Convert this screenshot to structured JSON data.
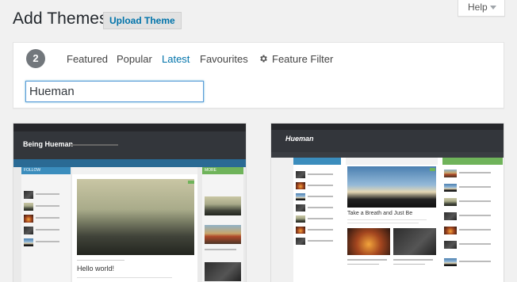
{
  "header": {
    "title": "Add Themes",
    "upload_label": "Upload Theme",
    "help_label": "Help"
  },
  "filter": {
    "count": "2",
    "tabs": [
      {
        "label": "Featured",
        "active": false
      },
      {
        "label": "Popular",
        "active": false
      },
      {
        "label": "Latest",
        "active": true
      },
      {
        "label": "Favourites",
        "active": false
      },
      {
        "label": "Feature Filter",
        "icon": "gear-icon",
        "active": false
      }
    ],
    "search_value": "Hueman"
  },
  "themes": [
    {
      "preview": {
        "site_title": "Being Hueman",
        "sidebar_label": "FOLLOW",
        "right_label": "MORE",
        "post_title": "Hello world!"
      }
    },
    {
      "preview": {
        "logo": "Hueman",
        "post_title": "Take a Breath and Just Be"
      }
    }
  ],
  "colors": {
    "accent": "#0073aa",
    "hueman_green": "#6fb35a",
    "hueman_blue": "#3b8dbd",
    "hueman_dark": "#33363b"
  }
}
